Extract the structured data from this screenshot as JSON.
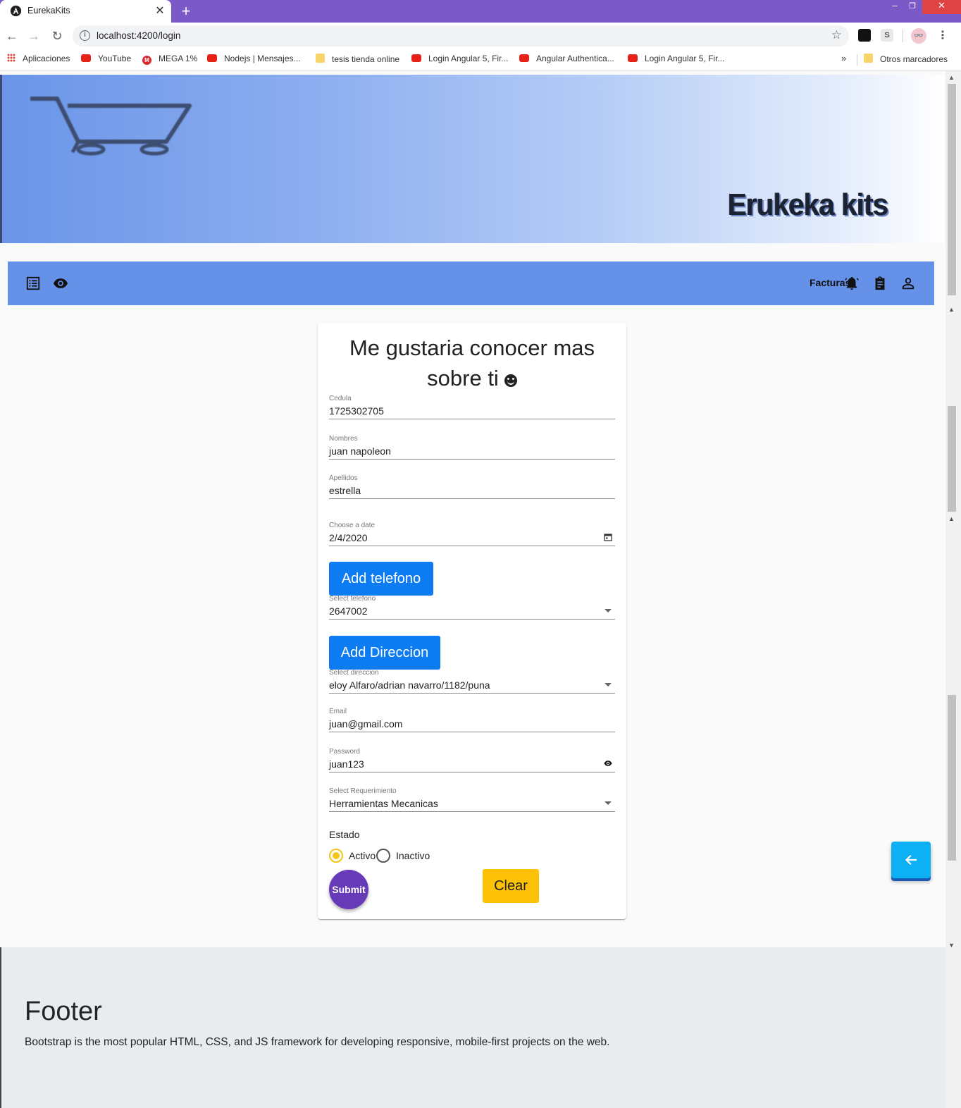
{
  "browser": {
    "tab_title": "EurekaKits",
    "url": "localhost:4200/login",
    "bookmarks": [
      {
        "label": "Aplicaciones",
        "icon": "apps-icon"
      },
      {
        "label": "YouTube",
        "icon": "youtube-icon"
      },
      {
        "label": "MEGA 1%",
        "icon": "mega-icon"
      },
      {
        "label": "Nodejs | Mensajes...",
        "icon": "youtube-icon"
      },
      {
        "label": "tesis tienda online",
        "icon": "folder-icon"
      },
      {
        "label": "Login Angular 5, Fir...",
        "icon": "youtube-icon"
      },
      {
        "label": "Angular Authentica...",
        "icon": "youtube-icon"
      },
      {
        "label": "Login Angular 5, Fir...",
        "icon": "youtube-icon"
      }
    ],
    "more_bookmarks": "»",
    "other_bookmarks": "Otros marcadores",
    "ext_s": "S"
  },
  "header": {
    "brand": "Erukeka kits"
  },
  "nav": {
    "facturas": "Facturas"
  },
  "form": {
    "title_line1": "Me gustaria conocer mas",
    "title_line2": "sobre ti",
    "cedula": {
      "label": "Cedula",
      "value": "1725302705"
    },
    "nombres": {
      "label": "Nombres",
      "value": "juan napoleon"
    },
    "apellidos": {
      "label": "Apellidos",
      "value": "estrella"
    },
    "fecha": {
      "label": "Choose a date",
      "value": "2/4/2020"
    },
    "add_telefono": "Add telefono",
    "telefono": {
      "label": "Select telefono",
      "value": "2647002"
    },
    "add_direccion": "Add Direccion",
    "direccion": {
      "label": "Select direccion",
      "value": "eloy Alfaro/adrian navarro/1182/puna"
    },
    "email": {
      "label": "Email",
      "value": "juan@gmail.com"
    },
    "password": {
      "label": "Password",
      "value": "juan123"
    },
    "requerimiento": {
      "label": "Select Requerimiento",
      "value": "Herramientas Mecanicas"
    },
    "estado_label": "Estado",
    "estado_options": [
      "Activo",
      "Inactivo"
    ],
    "estado_selected": "Activo",
    "submit": "Submit",
    "clear": "Clear"
  },
  "footer": {
    "title": "Footer",
    "text": "Bootstrap is the most popular HTML, CSS, and JS framework for developing responsive, mobile-first projects on the web."
  },
  "colors": {
    "titlebar": "#7b59c7",
    "nav": "#6592e8",
    "primary_button": "#0d7cf2",
    "submit": "#673ab7",
    "clear": "#fdc107",
    "radio": "#f5c518",
    "fab": "#0cb0f3"
  }
}
